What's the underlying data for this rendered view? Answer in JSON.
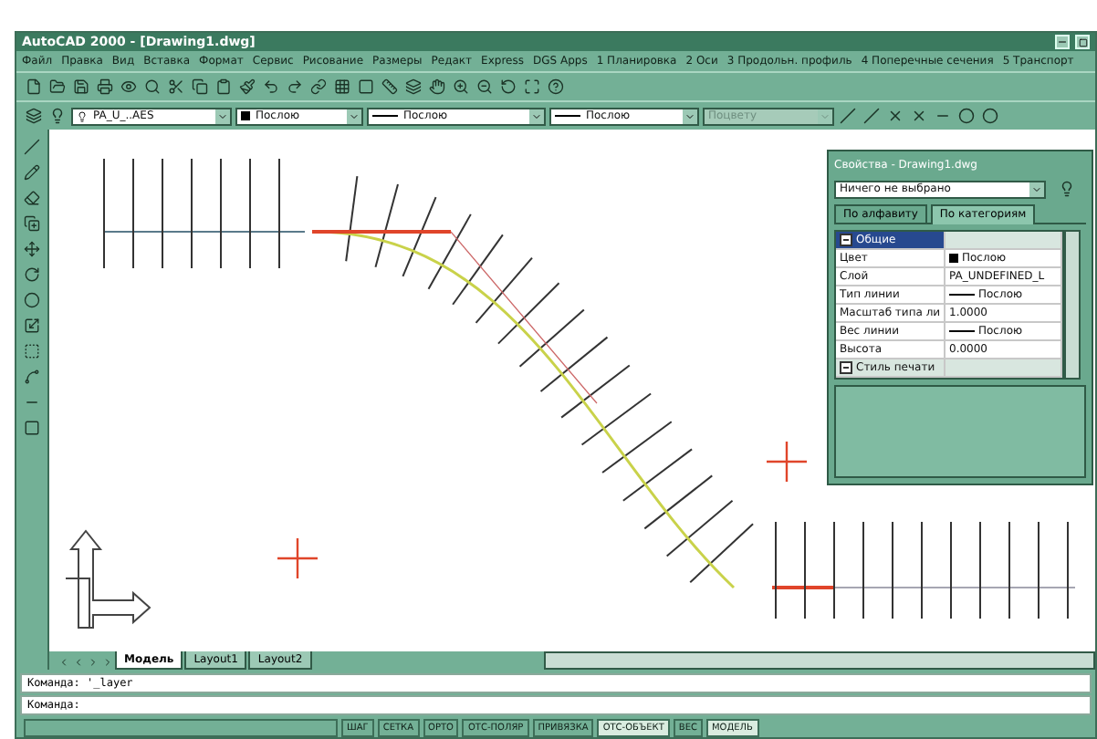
{
  "window": {
    "title": "AutoCAD 2000 - [Drawing1.dwg]"
  },
  "menu": [
    "Файл",
    "Правка",
    "Вид",
    "Вставка",
    "Формат",
    "Сервис",
    "Рисование",
    "Размеры",
    "Редакт",
    "Express",
    "DGS Apps",
    "1 Планировка",
    "2 Оси",
    "3 Продольн. профиль",
    "4 Поперечные сечения",
    "5 Транспорт"
  ],
  "properties_toolbar": {
    "layer": "PA_U_..AES",
    "color_setting": "Послою",
    "linetype": "Послою",
    "lineweight": "Послою",
    "plotstyle": {
      "value": "Поцвету",
      "disabled": true
    }
  },
  "properties_palette": {
    "title": "Свойства - Drawing1.dwg",
    "selection": "Ничего не выбрано",
    "tabs": [
      {
        "label": "По алфавиту",
        "selected": false
      },
      {
        "label": "По категориям",
        "selected": true
      }
    ],
    "rows": [
      {
        "kind": "section",
        "label": "Общие",
        "expanded": true,
        "selected": true
      },
      {
        "kind": "swatch",
        "label": "Цвет",
        "value": "Послою",
        "selected": false
      },
      {
        "kind": "text",
        "label": "Слой",
        "value": "PA_UNDEFINED_L",
        "selected": false
      },
      {
        "kind": "line",
        "label": "Тип линии",
        "value": "Послою",
        "selected": false
      },
      {
        "kind": "text",
        "label": "Масштаб типа ли",
        "value": "1.0000",
        "selected": false
      },
      {
        "kind": "line",
        "label": "Вес линии",
        "value": "Послою",
        "selected": false
      },
      {
        "kind": "text",
        "label": "Высота",
        "value": "0.0000",
        "selected": false
      },
      {
        "kind": "section",
        "label": "Стиль печати",
        "expanded": true,
        "selected": false
      }
    ]
  },
  "layout_tabs": [
    {
      "label": "Модель",
      "selected": true
    },
    {
      "label": "Layout1",
      "selected": false
    },
    {
      "label": "Layout2",
      "selected": false
    }
  ],
  "command_lines": [
    "Команда: '_layer",
    "Команда:"
  ],
  "status_buttons": [
    {
      "label": "ШАГ",
      "on": false
    },
    {
      "label": "СЕТКА",
      "on": false
    },
    {
      "label": "ОРТО",
      "on": false
    },
    {
      "label": "ОТС-ПОЛЯР",
      "on": false
    },
    {
      "label": "ПРИВЯЗКА",
      "on": false
    },
    {
      "label": "ОТС-ОБЪЕКТ",
      "on": true
    },
    {
      "label": "ВЕС",
      "on": false
    },
    {
      "label": "МОДЕЛЬ",
      "on": true
    }
  ]
}
